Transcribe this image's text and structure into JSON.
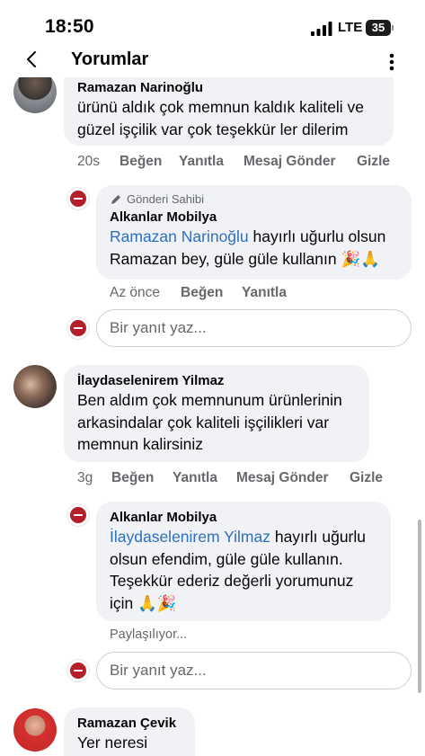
{
  "status": {
    "time": "18:50",
    "network": "LTE",
    "battery": "35"
  },
  "header": {
    "title": "Yorumlar"
  },
  "comments": [
    {
      "name": "Ramazan Narinoğlu",
      "text": "ürünü aldık çok memnun kaldık kaliteli ve güzel işçilik var çok teşekkür ler dilerim",
      "time": "20s",
      "like": "Beğen",
      "reply": "Yanıtla",
      "message": "Mesaj Gönder",
      "hide": "Gizle"
    },
    {
      "name": "İlaydaselenirem Yilmaz",
      "text": "Ben aldım çok memnunum ürünlerinin arkasindalar çok kaliteli işçilikleri var memnun kalirsiniz",
      "time": "3g",
      "like": "Beğen",
      "reply": "Yanıtla",
      "message": "Mesaj Gönder",
      "hide": "Gizle"
    },
    {
      "name": "Ramazan Çevik",
      "text": "Yer neresi"
    }
  ],
  "replies": [
    {
      "author_tag": "Gönderi Sahibi",
      "name": "Alkanlar Mobilya",
      "mention": "Ramazan Narinoğlu",
      "text_line1": " hayırlı uğurlu olsun",
      "text_line2": "Ramazan bey, güle güle kullanın 🎉🙏",
      "time": "Az önce",
      "like": "Beğen",
      "reply": "Yanıtla"
    },
    {
      "name": "Alkanlar Mobilya",
      "mention": "İlaydaselenirem Yilmaz",
      "text_rest": " hayırlı uğurlu olsun efendim, güle güle kullanın. Teşekkür ederiz değerli yorumunuz için 🙏🎉",
      "status": "Paylaşılıyor..."
    }
  ],
  "reply_input": {
    "placeholder": "Bir yanıt yaz..."
  },
  "icons": {
    "back": "chevron-left-icon",
    "more": "more-vertical-icon",
    "author": "pen-icon"
  },
  "colors": {
    "mention": "#2e6fbf",
    "bubble": "#f0f2f5",
    "muted_text": "#65676b",
    "brand_logo": "#b3202a"
  }
}
